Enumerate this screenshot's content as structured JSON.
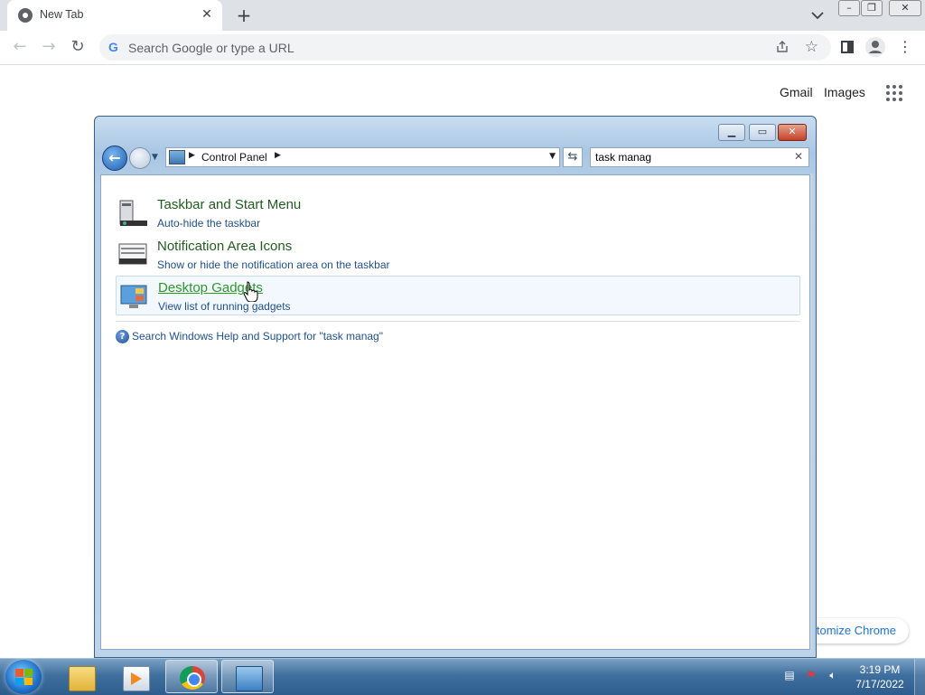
{
  "browser": {
    "tab_title": "New Tab",
    "omnibox_placeholder": "Search Google or type a URL",
    "g_letter": "G",
    "ntp_links": [
      "Gmail",
      "Images"
    ],
    "customize_label": "Customize Chrome"
  },
  "control_panel": {
    "breadcrumb": "Control Panel",
    "search_value": "task manag",
    "results": [
      {
        "title": "Taskbar and Start Menu",
        "subtitle": "Auto-hide the taskbar",
        "icon": "taskbar-icon"
      },
      {
        "title": "Notification Area Icons",
        "subtitle": "Show or hide the notification area on the taskbar",
        "icon": "notification-area-icon"
      },
      {
        "title": "Desktop Gadgets",
        "subtitle": "View list of running gadgets",
        "icon": "gadgets-icon",
        "hovered": true
      }
    ],
    "help_link": "Search Windows Help and Support for \"task manag\""
  },
  "taskbar": {
    "pinned": [
      "folder-icon",
      "media-player-icon",
      "chrome-icon",
      "control-panel-icon"
    ],
    "clock_time": "3:19 PM",
    "clock_date": "7/17/2022"
  },
  "colors": {
    "link_green": "#1e5e1e",
    "hover_green": "#2a9a2a",
    "sub_blue": "#1f4f8f",
    "taskbar": "#3f6f9e"
  }
}
